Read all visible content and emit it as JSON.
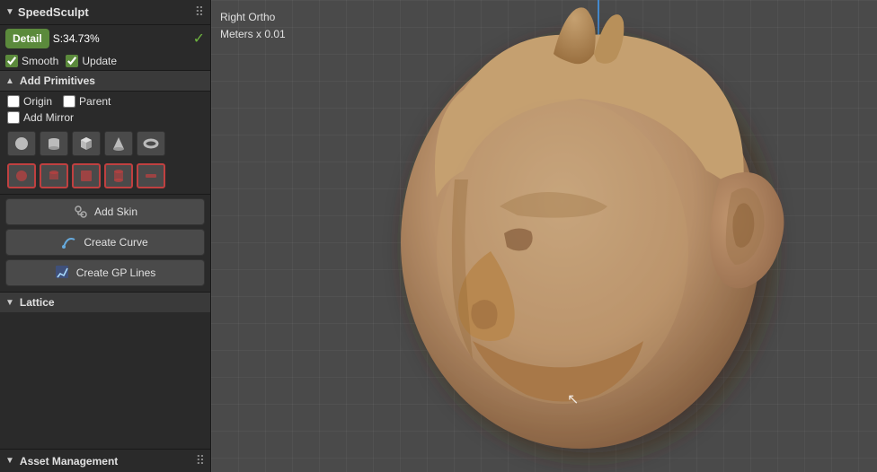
{
  "panel": {
    "title": "SpeedSculpt",
    "detail_label": "Detail",
    "detail_value": "S:34.73%",
    "check_mark": "✓",
    "smooth_label": "Smooth",
    "update_label": "Update",
    "add_primitives_label": "Add Primitives",
    "origin_label": "Origin",
    "parent_label": "Parent",
    "add_mirror_label": "Add Mirror",
    "add_skin_label": "Add Skin",
    "create_curve_label": "Create Curve",
    "create_gp_lines_label": "Create GP Lines",
    "lattice_label": "Lattice",
    "asset_management_label": "Asset Management"
  },
  "viewport": {
    "view_mode": "Right Ortho",
    "scale_info": "Meters x 0.01"
  },
  "shapes": {
    "top_row": [
      "●",
      "◯",
      "⬡",
      "▲",
      "◎"
    ],
    "bottom_row": [
      "⬤",
      "◉",
      "⬡",
      "◉",
      "▪"
    ]
  },
  "icons": {
    "skin_icon": "✦",
    "curve_icon": "✏",
    "gp_icon": "✏"
  }
}
